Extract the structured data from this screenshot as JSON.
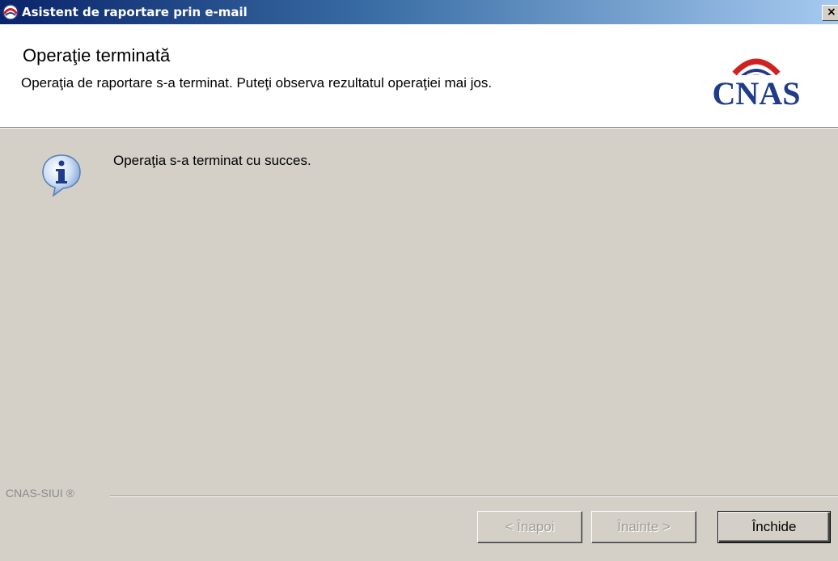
{
  "window": {
    "title": "Asistent de raportare prin e-mail",
    "close_label": "×"
  },
  "header": {
    "title": "Operaţie terminată",
    "subtitle": "Operaţia de raportare s-a terminat. Puteţi observa rezultatul operaţiei mai jos.",
    "logo_text": "CNAS"
  },
  "content": {
    "message": "Operaţia s-a terminat cu succes.",
    "icon": "info-icon"
  },
  "footer": {
    "brand": "CNAS-SIUI ®",
    "buttons": {
      "back": "< Înapoi",
      "next": "Înainte >",
      "close": "Închide"
    }
  },
  "colors": {
    "title_bar": "#0a246a",
    "dialog_bg": "#d4d0c8",
    "logo_blue": "#1f3c88",
    "logo_red": "#d02020"
  }
}
